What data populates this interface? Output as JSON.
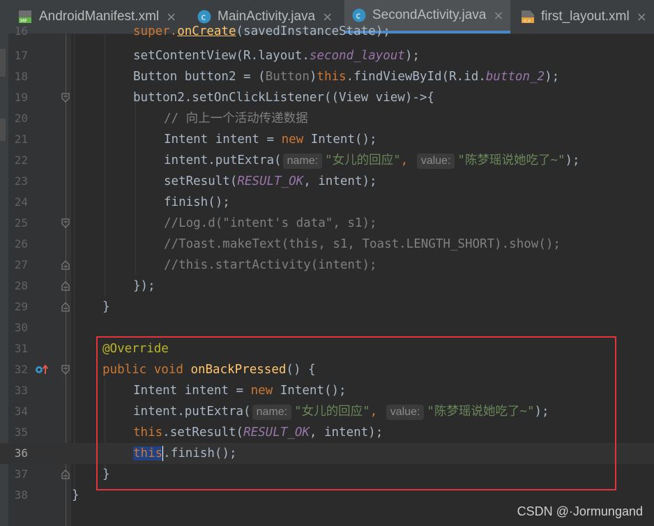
{
  "tabs": [
    {
      "label": "AndroidManifest.xml",
      "icon": "manifest-file-icon",
      "active": false
    },
    {
      "label": "MainActivity.java",
      "icon": "java-class-icon",
      "active": false
    },
    {
      "label": "SecondActivity.java",
      "icon": "java-class-icon",
      "active": true
    },
    {
      "label": "first_layout.xml",
      "icon": "xml-layout-file-icon",
      "active": false
    }
  ],
  "editor": {
    "current_line": "36",
    "lines": [
      {
        "num": "16",
        "p1": "super.",
        "p2": "onCreate",
        "p3": "(savedInstanceState);"
      },
      {
        "num": "17",
        "p1": "setContentView(R.layout.",
        "p2": "second_layout",
        "p3": ");"
      },
      {
        "num": "18",
        "p1": "Button button2 = (",
        "p2": "Button",
        "p3": ")",
        "p4": "this",
        "p5": ".findViewById(R.id.",
        "p6": "button_2",
        "p7": ");"
      },
      {
        "num": "19",
        "p1": "button2.setOnClickListener((View view)->{"
      },
      {
        "num": "20",
        "p1": "// 向上一个活动传递数据"
      },
      {
        "num": "21",
        "p1": "Intent intent = ",
        "p2": "new",
        "p3": " Intent();"
      },
      {
        "num": "22",
        "p1": "intent.putExtra(",
        "h1": "name:",
        "s1": "\"女儿的回应\"",
        "p2": ", ",
        "h2": "value:",
        "s2": "\"陈梦瑶说她吃了~\"",
        "p3": ");"
      },
      {
        "num": "23",
        "p1": "setResult(",
        "p2": "RESULT_OK",
        "p3": ", intent);"
      },
      {
        "num": "24",
        "p1": "finish();"
      },
      {
        "num": "25",
        "p1": "//Log.d(\"intent's data\", s1);"
      },
      {
        "num": "26",
        "p1": "//Toast.makeText(this, s1, Toast.LENGTH_SHORT).show();"
      },
      {
        "num": "27",
        "p1": "//this.startActivity(intent);"
      },
      {
        "num": "28",
        "p1": "});"
      },
      {
        "num": "29",
        "p1": "}"
      },
      {
        "num": "30",
        "p1": ""
      },
      {
        "num": "31",
        "p1": "@Override"
      },
      {
        "num": "32",
        "p1": "public void ",
        "p2": "onBackPressed",
        "p3": "() {"
      },
      {
        "num": "33",
        "p1": "Intent intent = ",
        "p2": "new",
        "p3": " Intent();"
      },
      {
        "num": "34",
        "p1": "intent.putExtra(",
        "h1": "name:",
        "s1": "\"女儿的回应\"",
        "p2": ", ",
        "h2": "value:",
        "s2": "\"陈梦瑶说她吃了~\"",
        "p3": ");"
      },
      {
        "num": "35",
        "p1": "this",
        "p2": ".setResult(",
        "p3": "RESULT_OK",
        "p4": ", intent);"
      },
      {
        "num": "36",
        "p1": "this",
        "p2": ".finish();"
      },
      {
        "num": "37",
        "p1": "}"
      },
      {
        "num": "38",
        "p1": "}"
      }
    ]
  },
  "watermark": "CSDN @·Jormungand",
  "colors": {
    "background": "#2b2b2b",
    "keyword": "#cc7832",
    "string": "#6a8759",
    "comment": "#808080",
    "annotation": "#bbb529",
    "method_declaration": "#ffc66d",
    "static_field": "#9876aa",
    "highlight_box": "#e0353a",
    "active_tab_underline": "#4a88c7"
  }
}
